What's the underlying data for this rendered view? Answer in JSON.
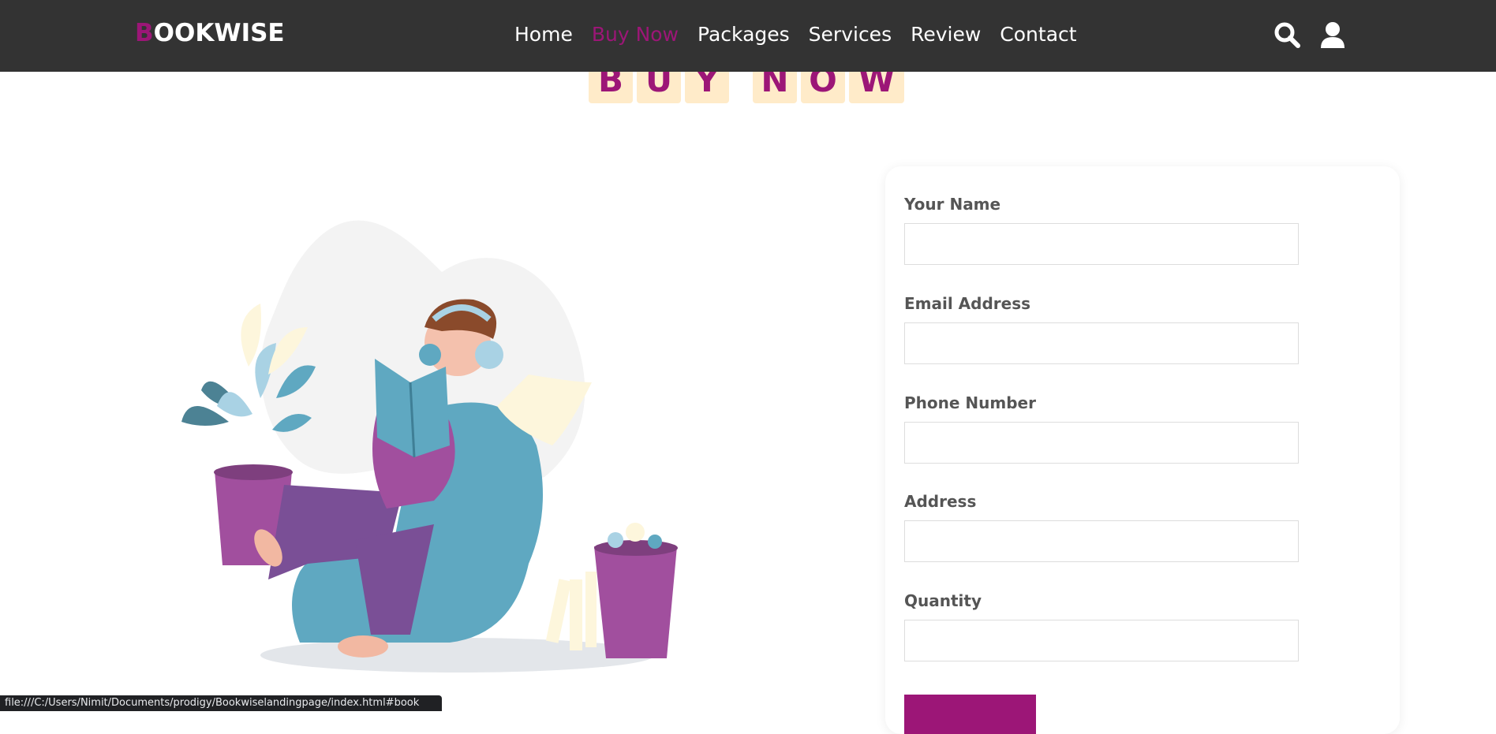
{
  "brand": {
    "first_letter": "B",
    "rest": "OOKWISE",
    "accent": "#9c1677"
  },
  "nav": {
    "items": [
      {
        "label": "Home",
        "active": false
      },
      {
        "label": "Buy Now",
        "active": true
      },
      {
        "label": "Packages",
        "active": false
      },
      {
        "label": "Services",
        "active": false
      },
      {
        "label": "Review",
        "active": false
      },
      {
        "label": "Contact",
        "active": false
      }
    ],
    "icons": [
      "search-icon",
      "user-icon"
    ]
  },
  "section": {
    "heading_word1": [
      "B",
      "U",
      "Y"
    ],
    "heading_word2": [
      "N",
      "O",
      "W"
    ],
    "tile_color": "#ffebc9"
  },
  "form": {
    "fields": [
      {
        "label": "Your Name",
        "value": ""
      },
      {
        "label": "Email Address",
        "value": ""
      },
      {
        "label": "Phone Number",
        "value": ""
      },
      {
        "label": "Address",
        "value": ""
      },
      {
        "label": "Quantity",
        "value": ""
      }
    ],
    "submit_label": ""
  },
  "status_bar": {
    "text": "file:///C:/Users/Nimit/Documents/prodigy/Bookwiselandingpage/index.html#book"
  }
}
